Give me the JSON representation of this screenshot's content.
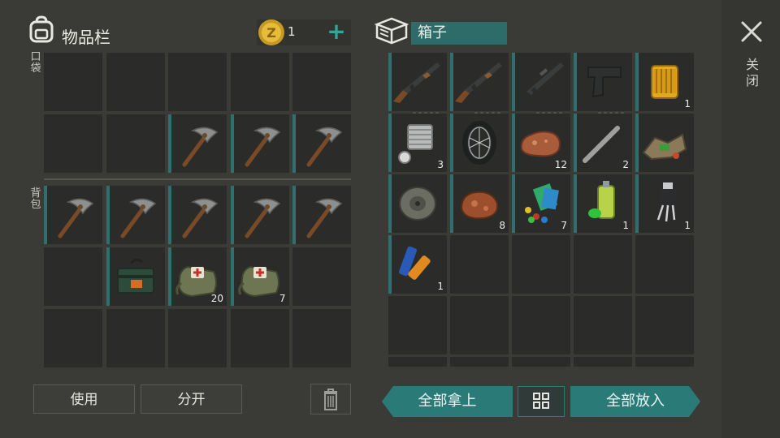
{
  "inventory": {
    "title": "物品栏",
    "pocket_label": "口袋",
    "backpack_label": "背包",
    "coins": "1",
    "add_label": "+"
  },
  "box": {
    "title": "箱子"
  },
  "close_label": "关闭",
  "buttons": {
    "use": "使用",
    "split": "分开",
    "take_all": "全部拿上",
    "put_all": "全部放入"
  },
  "pocket_slots": [
    {
      "item": "empty-slot"
    },
    {
      "item": "empty-slot"
    },
    {
      "item": "empty-slot"
    },
    {
      "item": "empty-slot"
    },
    {
      "item": "empty-slot"
    },
    {
      "item": "empty-slot"
    },
    {
      "item": "empty-slot"
    },
    {
      "item": "pickaxe-icon"
    },
    {
      "item": "pickaxe-icon"
    },
    {
      "item": "pickaxe-icon"
    }
  ],
  "backpack_slots": [
    {
      "item": "pickaxe-icon"
    },
    {
      "item": "pickaxe-icon"
    },
    {
      "item": "pickaxe-icon"
    },
    {
      "item": "pickaxe-icon"
    },
    {
      "item": "pickaxe-icon"
    },
    {
      "item": "empty-slot"
    },
    {
      "item": "ammo-box-icon"
    },
    {
      "item": "medkit-bag-icon",
      "count": "20"
    },
    {
      "item": "medkit-bag-icon",
      "count": "7"
    },
    {
      "item": "empty-slot"
    },
    {
      "item": "empty-slot"
    },
    {
      "item": "empty-slot"
    },
    {
      "item": "empty-slot"
    },
    {
      "item": "empty-slot"
    },
    {
      "item": "empty-slot"
    }
  ],
  "box_slots": [
    {
      "item": "ak-rifle-icon",
      "durability": true
    },
    {
      "item": "ak-rifle-icon",
      "durability": true
    },
    {
      "item": "m16-rifle-icon",
      "durability": true
    },
    {
      "item": "pistol-icon",
      "durability": true
    },
    {
      "item": "oil-filter-icon",
      "count": "1"
    },
    {
      "item": "engine-cylinder-icon",
      "count": "3"
    },
    {
      "item": "motorcycle-wheel-icon"
    },
    {
      "item": "copper-ore-icon",
      "count": "12"
    },
    {
      "item": "spring-icon",
      "count": "2"
    },
    {
      "item": "scrap-parts-icon"
    },
    {
      "item": "brake-disc-icon"
    },
    {
      "item": "raw-ore-icon",
      "count": "8"
    },
    {
      "item": "plastic-parts-icon",
      "count": "7"
    },
    {
      "item": "spray-paint-icon",
      "count": "1"
    },
    {
      "item": "transistor-icon",
      "count": "1"
    },
    {
      "item": "battery-icon",
      "count": "1"
    },
    {
      "item": "empty-slot"
    },
    {
      "item": "empty-slot"
    },
    {
      "item": "empty-slot"
    },
    {
      "item": "empty-slot"
    },
    {
      "item": "empty-slot"
    },
    {
      "item": "empty-slot"
    },
    {
      "item": "empty-slot"
    },
    {
      "item": "empty-slot"
    },
    {
      "item": "empty-slot"
    },
    {
      "item": "empty-slot"
    },
    {
      "item": "empty-slot"
    },
    {
      "item": "empty-slot"
    },
    {
      "item": "empty-slot"
    },
    {
      "item": "empty-slot"
    }
  ]
}
